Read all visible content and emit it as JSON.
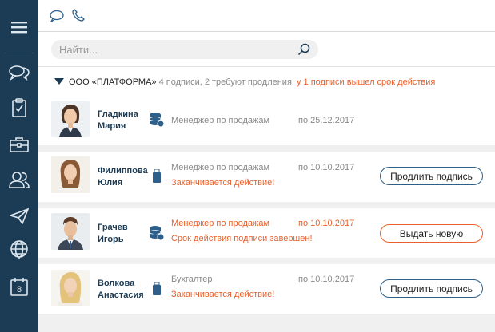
{
  "search": {
    "placeholder": "Найти..."
  },
  "organization": {
    "name": "ООО «ПЛАТФОРМА»",
    "info": "4 подписи, 2 требуют продления,",
    "alert": "у 1 подписи вышел срок действия"
  },
  "employees": [
    {
      "name_line1": "Гладкина",
      "name_line2": "Мария",
      "role": "Менеджер по продажам",
      "date": "по 25.12.2017",
      "status": "",
      "button": "",
      "device": "token-disk"
    },
    {
      "name_line1": "Филиппова",
      "name_line2": "Юлия",
      "role": "Менеджер по продажам",
      "date": "по 10.10.2017",
      "status": "Заканчивается действие!",
      "button": "Продлить подпись",
      "device": "usb-token"
    },
    {
      "name_line1": "Грачев",
      "name_line2": "Игорь",
      "role": "Менеджер по продажам",
      "date": "по 10.10.2017",
      "status": "Срок действия подписи завершен!",
      "button": "Выдать новую",
      "device": "token-disk"
    },
    {
      "name_line1": "Волкова",
      "name_line2": "Анастасия",
      "role": "Бухгалтер",
      "date": "по 10.10.2017",
      "status": "Заканчивается действие!",
      "button": "Продлить подпись",
      "device": "usb-token"
    }
  ],
  "sidebar": {
    "calendar_day": "8",
    "icons": [
      "menu-icon",
      "chat-icon",
      "clipboard-icon",
      "briefcase-icon",
      "users-icon",
      "send-icon",
      "globe-icon",
      "calendar-icon"
    ]
  },
  "topbar": {
    "icons": [
      "chat-bubble-icon",
      "phone-icon"
    ]
  },
  "colors": {
    "sidebar": "#1c3b54",
    "accent_blue": "#2d5f8a",
    "alert_orange": "#e8612c"
  }
}
